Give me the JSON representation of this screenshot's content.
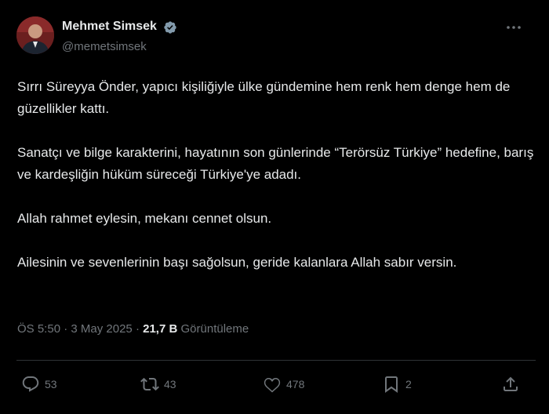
{
  "author": {
    "display_name": "Mehmet Simsek",
    "handle": "@memetsimsek",
    "verified_icon": "verified-badge-icon"
  },
  "tweet": {
    "paragraphs": [
      "Sırrı Süreyya Önder, yapıcı kişiliğiyle ülke gündemine hem renk hem denge hem de güzellikler kattı.",
      "Sanatçı ve bilge karakterini, hayatının son günlerinde “Terörsüz Türkiye” hedefine,  barış ve kardeşliğin hüküm süreceği Türkiye'ye adadı.",
      "Allah rahmet eylesin, mekanı cennet olsun.",
      "Ailesinin ve sevenlerinin başı sağolsun, geride kalanlara Allah sabır versin."
    ]
  },
  "meta": {
    "time": "ÖS 5:50",
    "date": "3 May 2025",
    "views_count": "21,7 B",
    "views_label": "Görüntüleme"
  },
  "actions": {
    "replies": "53",
    "retweets": "43",
    "likes": "478",
    "bookmarks": "2"
  },
  "colors": {
    "background": "#000000",
    "text": "#e7e9ea",
    "muted": "#71767b",
    "verified": "#829aab"
  }
}
